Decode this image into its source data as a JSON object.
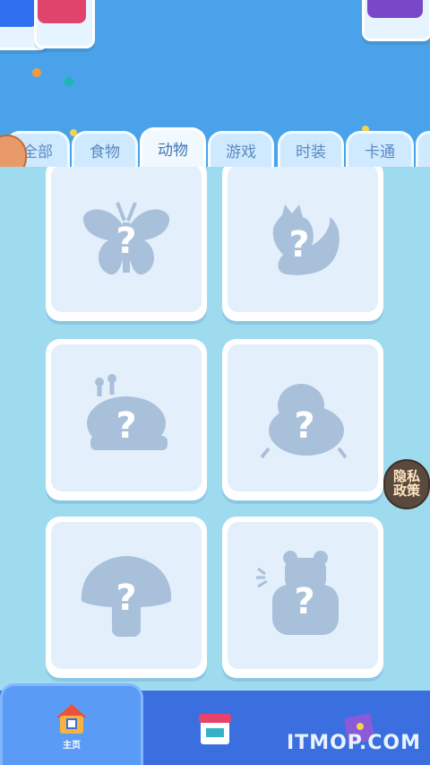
{
  "tabs": [
    {
      "label": "全部"
    },
    {
      "label": "食物"
    },
    {
      "label": "动物"
    },
    {
      "label": "游戏"
    },
    {
      "label": "时装"
    },
    {
      "label": "卡通"
    }
  ],
  "active_tab": "动物",
  "cards": [
    {
      "icon": "butterfly-silhouette-icon",
      "mark": "?"
    },
    {
      "icon": "squirrel-silhouette-icon",
      "mark": "?"
    },
    {
      "icon": "snail-silhouette-icon",
      "mark": "?"
    },
    {
      "icon": "bird-silhouette-icon",
      "mark": "?"
    },
    {
      "icon": "mushroom-silhouette-icon",
      "mark": "?"
    },
    {
      "icon": "bear-silhouette-icon",
      "mark": "?"
    }
  ],
  "privacy_button": {
    "line1": "隐私",
    "line2": "政策"
  },
  "bottom_nav": {
    "home_label": "主页"
  },
  "watermark": "ITMOP.COM",
  "colors": {
    "top_bg": "#4aa3ea",
    "content_bg": "#9fdbef",
    "silhouette": "#a9c0da",
    "nav_bg": "#3b6fe0"
  }
}
